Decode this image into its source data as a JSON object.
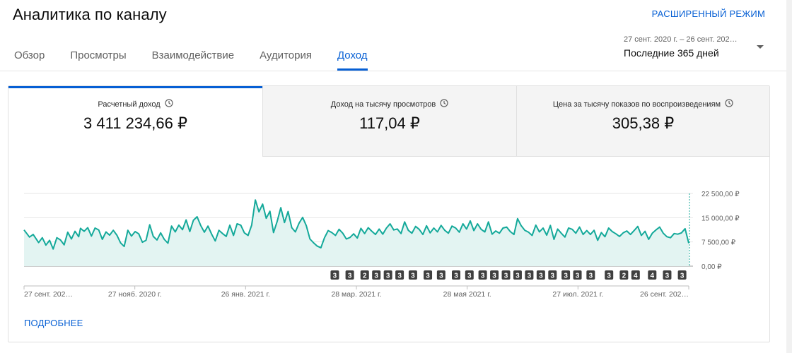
{
  "header": {
    "title": "Аналитика по каналу",
    "advanced_mode": "РАСШИРЕННЫЙ РЕЖИМ"
  },
  "tabs": [
    {
      "label": "Обзор",
      "active": false
    },
    {
      "label": "Просмотры",
      "active": false
    },
    {
      "label": "Взаимодействие",
      "active": false
    },
    {
      "label": "Аудитория",
      "active": false
    },
    {
      "label": "Доход",
      "active": true
    }
  ],
  "date_range": {
    "range_text": "27 сент. 2020 г. – 26 сент. 202…",
    "selected": "Последние 365 дней"
  },
  "metrics": [
    {
      "label": "Расчетный доход",
      "value": "3 411 234,66 ₽"
    },
    {
      "label": "Доход на тысячу просмотров",
      "value": "117,04 ₽"
    },
    {
      "label": "Цена за тысячу показов по воспроизведениям",
      "value": "305,38 ₽"
    }
  ],
  "details_link": "ПОДРОБНЕЕ",
  "colors": {
    "accent": "#065fd4",
    "line": "#14a99a",
    "fill": "#e3f4f2"
  },
  "chart_data": {
    "type": "area",
    "x_tick_labels": [
      "27 сент. 202…",
      "27 нояб. 2020 г.",
      "26 янв. 2021 г.",
      "28 мар. 2021 г.",
      "28 мая 2021 г.",
      "27 июл. 2021 г.",
      "26 сент. 202…"
    ],
    "y_tick_labels": [
      "22 500,00 ₽",
      "15 000,00 ₽",
      "7 500,00 ₽",
      "0,00 ₽"
    ],
    "ylim": [
      0,
      22500
    ],
    "y_ticks": [
      0,
      7500,
      15000,
      22500
    ],
    "x_days": 365,
    "points": [
      [
        0,
        11200
      ],
      [
        3,
        9000
      ],
      [
        5,
        9800
      ],
      [
        8,
        7300
      ],
      [
        10,
        8800
      ],
      [
        12,
        6500
      ],
      [
        14,
        8000
      ],
      [
        16,
        5300
      ],
      [
        18,
        8800
      ],
      [
        20,
        8100
      ],
      [
        22,
        6600
      ],
      [
        24,
        10500
      ],
      [
        26,
        8400
      ],
      [
        28,
        10800
      ],
      [
        30,
        9100
      ],
      [
        31,
        11700
      ],
      [
        33,
        10800
      ],
      [
        35,
        11900
      ],
      [
        37,
        9300
      ],
      [
        39,
        11800
      ],
      [
        41,
        11200
      ],
      [
        43,
        8300
      ],
      [
        45,
        10600
      ],
      [
        47,
        9600
      ],
      [
        49,
        11100
      ],
      [
        51,
        9600
      ],
      [
        53,
        7200
      ],
      [
        55,
        6100
      ],
      [
        57,
        11100
      ],
      [
        59,
        9300
      ],
      [
        61,
        10700
      ],
      [
        63,
        10000
      ],
      [
        65,
        7400
      ],
      [
        67,
        8000
      ],
      [
        69,
        12800
      ],
      [
        71,
        9200
      ],
      [
        73,
        8100
      ],
      [
        75,
        10300
      ],
      [
        77,
        8300
      ],
      [
        79,
        7100
      ],
      [
        81,
        12400
      ],
      [
        83,
        10600
      ],
      [
        85,
        12700
      ],
      [
        87,
        11300
      ],
      [
        89,
        14300
      ],
      [
        91,
        10700
      ],
      [
        93,
        14200
      ],
      [
        95,
        15300
      ],
      [
        97,
        12600
      ],
      [
        99,
        10500
      ],
      [
        101,
        12400
      ],
      [
        103,
        9900
      ],
      [
        105,
        7800
      ],
      [
        107,
        11100
      ],
      [
        109,
        10100
      ],
      [
        111,
        9200
      ],
      [
        113,
        12700
      ],
      [
        115,
        9500
      ],
      [
        117,
        13100
      ],
      [
        119,
        12700
      ],
      [
        121,
        10300
      ],
      [
        123,
        9500
      ],
      [
        125,
        12700
      ],
      [
        127,
        20500
      ],
      [
        129,
        16800
      ],
      [
        131,
        19200
      ],
      [
        133,
        14800
      ],
      [
        135,
        17000
      ],
      [
        137,
        10400
      ],
      [
        139,
        13900
      ],
      [
        141,
        18100
      ],
      [
        143,
        13500
      ],
      [
        145,
        16900
      ],
      [
        147,
        11900
      ],
      [
        149,
        10600
      ],
      [
        151,
        13300
      ],
      [
        153,
        15100
      ],
      [
        155,
        12500
      ],
      [
        157,
        8400
      ],
      [
        159,
        7200
      ],
      [
        161,
        6200
      ],
      [
        163,
        5700
      ],
      [
        165,
        8800
      ],
      [
        167,
        11000
      ],
      [
        169,
        10400
      ],
      [
        171,
        9500
      ],
      [
        173,
        11400
      ],
      [
        175,
        10200
      ],
      [
        177,
        8400
      ],
      [
        179,
        8900
      ],
      [
        181,
        10000
      ],
      [
        183,
        8700
      ],
      [
        185,
        11700
      ],
      [
        187,
        10100
      ],
      [
        189,
        11900
      ],
      [
        191,
        10800
      ],
      [
        193,
        9800
      ],
      [
        195,
        11500
      ],
      [
        197,
        9900
      ],
      [
        199,
        11800
      ],
      [
        201,
        13100
      ],
      [
        203,
        11200
      ],
      [
        205,
        11500
      ],
      [
        207,
        10100
      ],
      [
        209,
        13700
      ],
      [
        211,
        11100
      ],
      [
        213,
        10200
      ],
      [
        215,
        12300
      ],
      [
        217,
        11400
      ],
      [
        219,
        9800
      ],
      [
        221,
        12500
      ],
      [
        223,
        10300
      ],
      [
        225,
        11800
      ],
      [
        227,
        10600
      ],
      [
        229,
        12600
      ],
      [
        231,
        11100
      ],
      [
        233,
        10200
      ],
      [
        235,
        12400
      ],
      [
        237,
        11800
      ],
      [
        239,
        10500
      ],
      [
        241,
        13100
      ],
      [
        243,
        11500
      ],
      [
        245,
        14000
      ],
      [
        247,
        11000
      ],
      [
        249,
        13100
      ],
      [
        251,
        11400
      ],
      [
        253,
        10600
      ],
      [
        255,
        13700
      ],
      [
        257,
        9900
      ],
      [
        259,
        10900
      ],
      [
        261,
        10200
      ],
      [
        263,
        11800
      ],
      [
        265,
        12100
      ],
      [
        267,
        10700
      ],
      [
        269,
        9800
      ],
      [
        271,
        14700
      ],
      [
        273,
        12500
      ],
      [
        275,
        11100
      ],
      [
        277,
        10500
      ],
      [
        279,
        9500
      ],
      [
        281,
        12700
      ],
      [
        283,
        10600
      ],
      [
        285,
        11800
      ],
      [
        287,
        9600
      ],
      [
        289,
        12600
      ],
      [
        291,
        8300
      ],
      [
        293,
        11500
      ],
      [
        295,
        10200
      ],
      [
        297,
        9000
      ],
      [
        299,
        11800
      ],
      [
        301,
        11400
      ],
      [
        303,
        10200
      ],
      [
        305,
        12100
      ],
      [
        307,
        9800
      ],
      [
        309,
        11000
      ],
      [
        311,
        9800
      ],
      [
        313,
        11100
      ],
      [
        315,
        8000
      ],
      [
        317,
        10400
      ],
      [
        319,
        9100
      ],
      [
        321,
        11800
      ],
      [
        323,
        10700
      ],
      [
        325,
        10000
      ],
      [
        327,
        9200
      ],
      [
        329,
        10300
      ],
      [
        331,
        10900
      ],
      [
        333,
        9800
      ],
      [
        335,
        11000
      ],
      [
        337,
        12300
      ],
      [
        339,
        9500
      ],
      [
        341,
        10800
      ],
      [
        343,
        8300
      ],
      [
        345,
        10200
      ],
      [
        347,
        11200
      ],
      [
        349,
        12100
      ],
      [
        351,
        10200
      ],
      [
        353,
        9100
      ],
      [
        355,
        8800
      ],
      [
        357,
        10100
      ],
      [
        359,
        9900
      ],
      [
        361,
        10300
      ],
      [
        363,
        11600
      ],
      [
        365,
        7100
      ]
    ],
    "event_markers": [
      {
        "label": "3",
        "day": 187
      },
      {
        "label": "3",
        "day": 196
      },
      {
        "label": "2",
        "day": 205
      },
      {
        "label": "3",
        "day": 212
      },
      {
        "label": "3",
        "day": 219
      },
      {
        "label": "3",
        "day": 226
      },
      {
        "label": "3",
        "day": 234
      },
      {
        "label": "3",
        "day": 243
      },
      {
        "label": "3",
        "day": 251
      },
      {
        "label": "3",
        "day": 260
      },
      {
        "label": "3",
        "day": 268
      },
      {
        "label": "3",
        "day": 276
      },
      {
        "label": "3",
        "day": 283
      },
      {
        "label": "3",
        "day": 290
      },
      {
        "label": "3",
        "day": 297
      },
      {
        "label": "3",
        "day": 304
      },
      {
        "label": "3",
        "day": 311
      },
      {
        "label": "3",
        "day": 318
      },
      {
        "label": "3",
        "day": 326
      },
      {
        "label": "3",
        "day": 333
      },
      {
        "label": "3",
        "day": 341
      },
      {
        "label": "3",
        "day": 352
      },
      {
        "label": "2",
        "day": 361
      },
      {
        "label": "4",
        "day": 368
      },
      {
        "label": "4",
        "day": 378
      },
      {
        "label": "3",
        "day": 387
      },
      {
        "label": "3",
        "day": 396
      }
    ],
    "grid": true,
    "legend": "none"
  }
}
